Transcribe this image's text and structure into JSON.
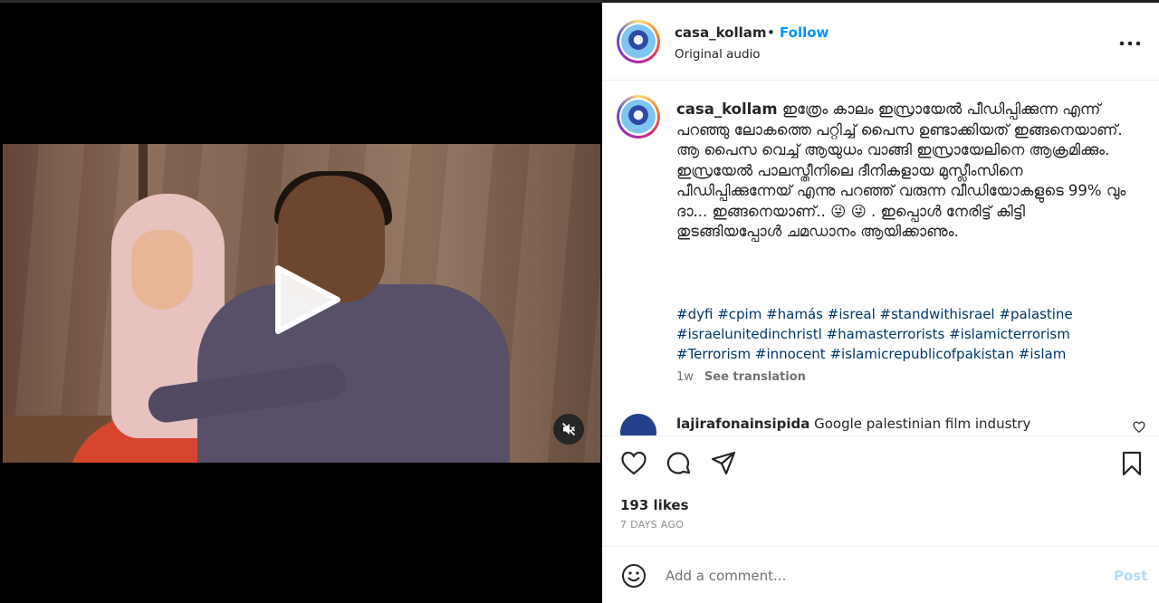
{
  "video": {
    "play_icon": "play-icon",
    "mute_icon": "volume-muted-icon"
  },
  "header": {
    "username": "casa_kollam",
    "separator": "•",
    "follow_label": "Follow",
    "audio": "Original audio",
    "more_icon": "more-horizontal-icon"
  },
  "caption": {
    "username": "casa_kollam",
    "text": " ഇത്രേം കാലം ഇസ്രായേൽ പീഡിപ്പിക്കുന്ന എന്ന് പറഞ്ഞു ലോകത്തെ പറ്റിച്ച് പൈസ ഉണ്ടാക്കിയത് ഇങ്ങനെയാണ്. ആ പൈസ വെച്ച് ആയുധം വാങ്ങി ഇസ്രായേലിനെ ആക്രമിക്കും. ഇസ്രയേൽ പാലസ്തീനിലെ ദീനികളായ മുസ്ലീംസിനെ പീഡിപ്പിക്കുന്നേയ് എന്നു പറഞ്ഞ് വരുന്ന വീഡിയോകളുടെ 99% വും ദാ... ഇങ്ങനെയാണ്.. 😜 😜 . ഇപ്പൊൾ നേരിട്ട് കിട്ടി തുടങ്ങിയപ്പോൾ ചമഡാനം ആയിക്കാണും.",
    "hashtags": [
      "#dyfi",
      "#cpim",
      "#hamás",
      "#isreal",
      "#standwithisrael",
      "#palastine",
      "#israelunitedinchristl",
      "#hamasterrorists",
      "#islamicterrorism",
      "#Terrorism",
      "#innocent",
      "#islamicrepublicofpakistan",
      "#islam"
    ],
    "time": "1w",
    "translation": "See translation"
  },
  "comment": {
    "username": "lajirafonainsipida",
    "text": "Google palestinian film industry"
  },
  "actions": {
    "like_icon": "heart-icon",
    "comment_icon": "comment-icon",
    "share_icon": "share-icon",
    "save_icon": "bookmark-icon",
    "likes": "193 likes",
    "ago": "7 DAYS AGO"
  },
  "add_comment": {
    "emoji_icon": "emoji-icon",
    "placeholder": "Add a comment...",
    "post_label": "Post"
  },
  "colors": {
    "link_blue": "#0095f6",
    "hashtag_blue": "#00376b",
    "post_disabled": "#b3dbff"
  }
}
